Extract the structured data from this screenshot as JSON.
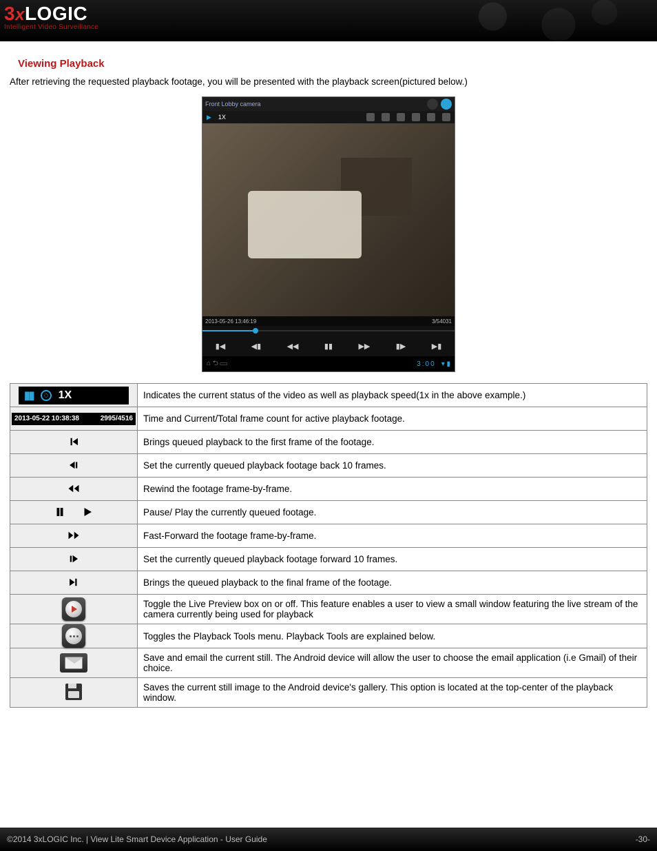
{
  "header": {
    "logo_prefix": "3",
    "logo_x": "x",
    "logo_rest": "LOGIC",
    "tagline": "Intelligent Video Surveillance"
  },
  "section": {
    "title": "Viewing Playback",
    "intro": "After retrieving the requested playback footage, you will be presented with the playback screen(pictured below.)"
  },
  "screenshot": {
    "camera_name": "Front Lobby camera",
    "speed_badge": "1X",
    "time_left": "2013-05-26 13:46:19",
    "time_right": "3/54031",
    "clock": "3:00"
  },
  "status": {
    "speed": "1X",
    "timestamp": "2013-05-22 10:38:38",
    "framecount": "2995/4516"
  },
  "rows": [
    {
      "key": "status",
      "desc": "Indicates the current status of the video as well as playback speed(1x in the above example.)"
    },
    {
      "key": "timecount",
      "desc": "Time and Current/Total frame count for active playback footage."
    },
    {
      "key": "first",
      "desc": "Brings queued playback to the first frame of the footage."
    },
    {
      "key": "back10",
      "desc": "Set the currently queued playback footage back 10 frames."
    },
    {
      "key": "rewind",
      "desc": "Rewind the footage frame-by-frame."
    },
    {
      "key": "pauseplay",
      "desc": "Pause/ Play the currently queued footage."
    },
    {
      "key": "ffwd",
      "desc": "Fast-Forward the footage frame-by-frame."
    },
    {
      "key": "fwd10",
      "desc": "Set the currently queued playback footage forward 10 frames."
    },
    {
      "key": "last",
      "desc": "Brings the queued playback to the final frame of the footage."
    },
    {
      "key": "livepreview",
      "desc": "Toggle the Live Preview box on or off. This feature enables a user to view a small window featuring the live stream of the camera currently being used for playback"
    },
    {
      "key": "tools",
      "desc": "Toggles the Playback Tools menu. Playback Tools are explained below."
    },
    {
      "key": "email",
      "desc": "Save and email the current still. The Android device will allow the user to choose the email application (i.e Gmail) of their choice."
    },
    {
      "key": "savestill",
      "desc": "Saves the current still image to the Android device's gallery. This option is located at the top-center of the playback window."
    }
  ],
  "footer": {
    "left": "©2014 3xLOGIC Inc.  |  View Lite Smart Device Application - User Guide",
    "right": "-30-"
  }
}
